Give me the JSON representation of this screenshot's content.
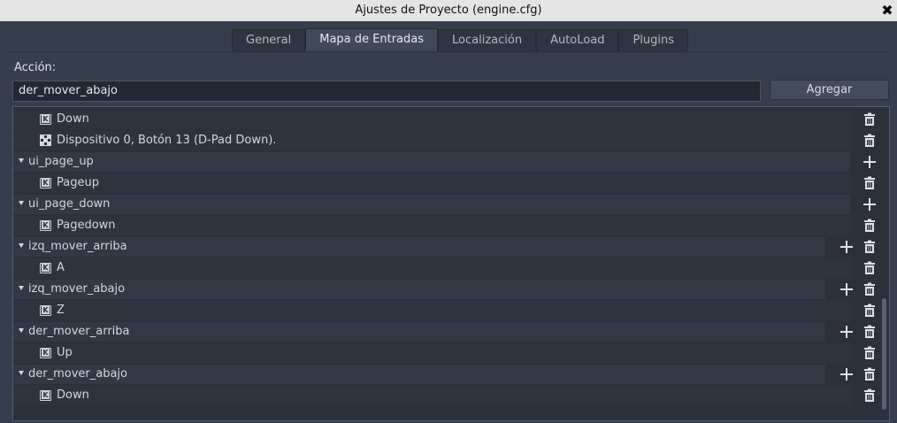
{
  "window": {
    "title": "Ajustes de Proyecto (engine.cfg)",
    "close_glyph": "✖"
  },
  "tabs": [
    {
      "label": "General",
      "active": false
    },
    {
      "label": "Mapa de Entradas",
      "active": true
    },
    {
      "label": "Localización",
      "active": false
    },
    {
      "label": "AutoLoad",
      "active": false
    },
    {
      "label": "Plugins",
      "active": false
    }
  ],
  "action": {
    "label": "Acción:",
    "value": "der_mover_abajo",
    "add_button": "Agregar"
  },
  "tree": {
    "rows": [
      {
        "kind": "child",
        "icon": "keyboard-icon",
        "text": "Down"
      },
      {
        "kind": "child",
        "icon": "joypad-icon",
        "text": "Dispositivo 0, Botón 13 (D-Pad Down)."
      },
      {
        "kind": "parent",
        "text": "ui_page_up",
        "buttons": [
          "plus"
        ]
      },
      {
        "kind": "child",
        "icon": "keyboard-icon",
        "text": "Pageup"
      },
      {
        "kind": "parent",
        "text": "ui_page_down",
        "buttons": [
          "plus"
        ]
      },
      {
        "kind": "child",
        "icon": "keyboard-icon",
        "text": "Pagedown"
      },
      {
        "kind": "parent",
        "text": "izq_mover_arriba",
        "buttons": [
          "plus",
          "trash"
        ]
      },
      {
        "kind": "child",
        "icon": "keyboard-icon",
        "text": "A"
      },
      {
        "kind": "parent",
        "text": "izq_mover_abajo",
        "buttons": [
          "plus",
          "trash"
        ]
      },
      {
        "kind": "child",
        "icon": "keyboard-icon",
        "text": "Z"
      },
      {
        "kind": "parent",
        "text": "der_mover_arriba",
        "buttons": [
          "plus",
          "trash"
        ]
      },
      {
        "kind": "child",
        "icon": "keyboard-icon",
        "text": "Up"
      },
      {
        "kind": "parent",
        "text": "der_mover_abajo",
        "buttons": [
          "plus",
          "trash"
        ]
      },
      {
        "kind": "child",
        "icon": "keyboard-icon",
        "text": "Down"
      }
    ]
  },
  "colors": {
    "background": "#373e4b",
    "tree_background": "#2b303a",
    "tree_border": "#4a5c7a",
    "icon": "#e0e2e6"
  }
}
